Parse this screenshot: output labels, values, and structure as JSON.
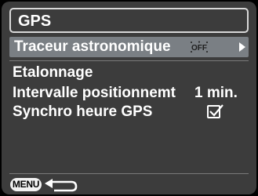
{
  "header": {
    "title": "GPS"
  },
  "menu": {
    "items": [
      {
        "label": "Traceur astronomique",
        "value_icon": "off-icon",
        "selected": true
      },
      {
        "label": "Etalonnage"
      },
      {
        "label": "Intervalle positionnemt",
        "value": "1 min."
      },
      {
        "label": "Synchro heure GPS",
        "checked": true
      }
    ]
  },
  "footer": {
    "menu_button_label": "MENU",
    "back_icon": "return-arrow-icon"
  },
  "colors": {
    "background": "#3c3c3c",
    "selection": "#7a7f84",
    "text": "#ffffff"
  }
}
